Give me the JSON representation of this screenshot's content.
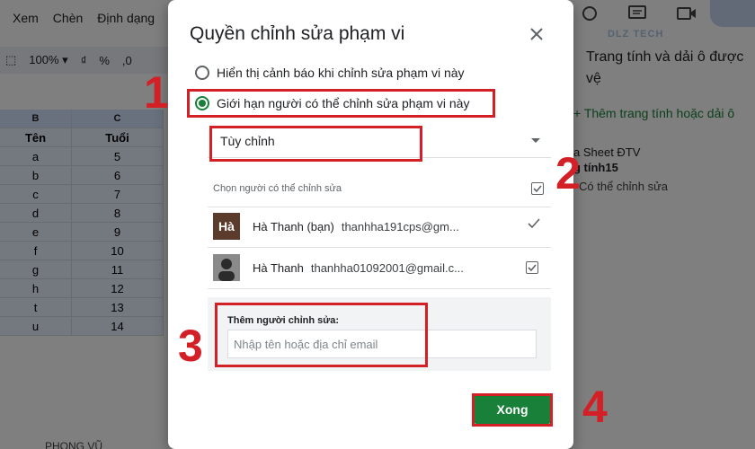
{
  "menu": {
    "view": "Xem",
    "insert": "Chèn",
    "format": "Định dạng"
  },
  "toolbar": {
    "zoom": "100%",
    "currency": "₫",
    "percent": "%",
    "decimal": ",0"
  },
  "sheet": {
    "col_b": "B",
    "col_c": "C",
    "header": [
      "Tên",
      "Tuổi"
    ],
    "rows": [
      [
        "a",
        "5"
      ],
      [
        "b",
        "6"
      ],
      [
        "c",
        "7"
      ],
      [
        "d",
        "8"
      ],
      [
        "e",
        "9"
      ],
      [
        "f",
        "10"
      ],
      [
        "g",
        "11"
      ],
      [
        "h",
        "12"
      ],
      [
        "t",
        "13"
      ],
      [
        "u",
        "14"
      ]
    ],
    "bottom_tab": "PHONG VŨ"
  },
  "side_panel": {
    "title": "Trang tính và dải ô được vệ",
    "add_link": "Thêm trang tính hoặc dải ô",
    "item_name": "a Sheet ĐTV",
    "item_range": "g tính15",
    "item_permission": "Có thể chỉnh sửa",
    "watermark": "DLZ TECH"
  },
  "dialog": {
    "title": "Quyền chỉnh sửa phạm vi",
    "option_warn": "Hiển thị cảnh báo khi chỉnh sửa phạm vi này",
    "option_restrict": "Giới hạn người có thể chỉnh sửa phạm vi này",
    "select_value": "Tùy chỉnh",
    "editors_label": "Chọn người có thể chỉnh sửa",
    "users": [
      {
        "initials": "Hà",
        "name": "Hà Thanh (bạn)",
        "email": "thanhha191cps@gm..."
      },
      {
        "initials": "",
        "name": "Hà Thanh",
        "email": "thanhha01092001@gmail.c..."
      }
    ],
    "add_label": "Thêm người chỉnh sửa:",
    "add_placeholder": "Nhập tên hoặc địa chỉ email",
    "done_label": "Xong"
  },
  "annotations": {
    "step1": "1",
    "step2": "2",
    "step3": "3",
    "step4": "4"
  },
  "colors": {
    "accent_green": "#188038",
    "annotation_red": "#d32027"
  }
}
